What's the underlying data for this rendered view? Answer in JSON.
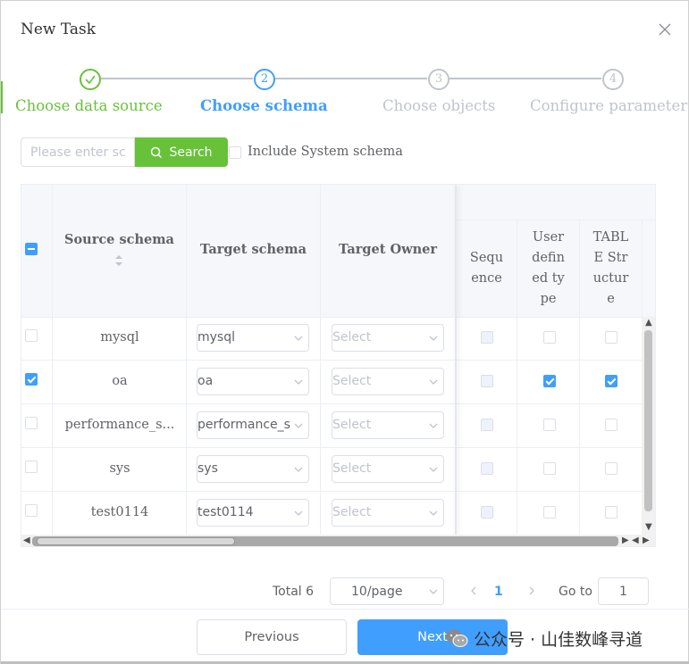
{
  "dialog": {
    "title": "New Task"
  },
  "steps": [
    {
      "num": "1",
      "label": "Choose data source",
      "state": "done"
    },
    {
      "num": "2",
      "label": "Choose schema",
      "state": "active"
    },
    {
      "num": "3",
      "label": "Choose objects",
      "state": "pending"
    },
    {
      "num": "4",
      "label": "Configure parameter",
      "state": "pending"
    }
  ],
  "search": {
    "placeholder": "Please enter schema",
    "button_label": "Search",
    "include_system_label": "Include System schema"
  },
  "table": {
    "headers": {
      "source_schema": "Source schema",
      "target_schema": "Target schema",
      "target_owner": "Target Owner",
      "sequence": [
        "Sequ",
        "ence"
      ],
      "user_defined_type": [
        "User",
        "defin",
        "ed ty",
        "pe"
      ],
      "table_structure": [
        "TABL",
        "E Str",
        "uctur",
        "e"
      ]
    },
    "owner_placeholder": "Select",
    "rows": [
      {
        "checked": false,
        "source": "mysql",
        "target": "mysql",
        "user_defined_type": false,
        "table_structure": false
      },
      {
        "checked": true,
        "source": "oa",
        "target": "oa",
        "user_defined_type": true,
        "table_structure": true
      },
      {
        "checked": false,
        "source": "performance_s...",
        "target": "performance_s",
        "user_defined_type": false,
        "table_structure": false
      },
      {
        "checked": false,
        "source": "sys",
        "target": "sys",
        "user_defined_type": false,
        "table_structure": false
      },
      {
        "checked": false,
        "source": "test0114",
        "target": "test0114",
        "user_defined_type": false,
        "table_structure": false
      }
    ]
  },
  "pagination": {
    "total": "Total 6",
    "page_size": "10/page",
    "current_page": "1",
    "goto_label": "Go to",
    "goto_value": "1"
  },
  "footer": {
    "previous_label": "Previous",
    "next_label": "Next"
  },
  "watermark": {
    "text": "公众号 · 山佳数峰寻道"
  },
  "colors": {
    "success": "#67c23a",
    "primary": "#409eff",
    "muted": "#c0c4cc"
  }
}
